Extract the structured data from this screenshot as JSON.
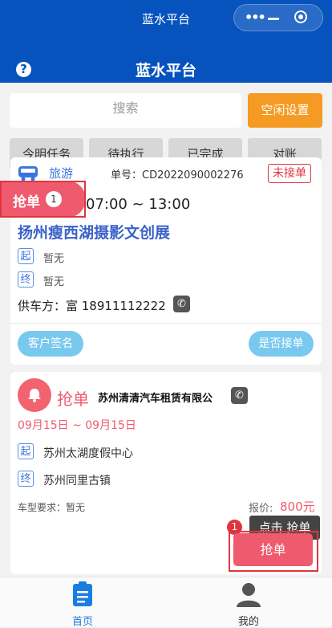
{
  "window": {
    "title": "蓝水平台"
  },
  "header": {
    "help_icon": "?",
    "title": "蓝水平台"
  },
  "search": {
    "placeholder": "搜索",
    "idle_button": "空闲设置"
  },
  "tabs": [
    "今明任务",
    "待执行",
    "已完成",
    "对账"
  ],
  "order_card": {
    "type": "旅游",
    "order_no": "单号：CD2022090002276",
    "status": "未接单",
    "time": "07:00 ~ 13:00",
    "title": "扬州瘦西湖摄影文创展",
    "start_tag": "起",
    "start": "暂无",
    "end_tag": "终",
    "end": "暂无",
    "supplier": "供车方：富 18911112222",
    "buttons": {
      "sign": "客户签名",
      "accept": "是否接单"
    }
  },
  "grab_badge": {
    "label": "抢单",
    "count": "1"
  },
  "grab_card": {
    "label": "抢单",
    "company": "苏州清清汽车租赁有限公",
    "dates": "09月15日 ~ 09月15日",
    "start_tag": "起",
    "start": "苏州太湖度假中心",
    "end_tag": "终",
    "end": "苏州同里古镇",
    "car_req": "车型要求：暂无",
    "price_label": "报价:",
    "price": "800元",
    "button": "抢单"
  },
  "guide": {
    "step": "1",
    "tooltip": "点击 抢单"
  },
  "tabbar": {
    "home": "首页",
    "mine": "我的"
  },
  "colors": {
    "primary": "#0753be",
    "accent": "#f05a6e",
    "orange": "#f59a23",
    "light_blue": "#79c9ef"
  }
}
